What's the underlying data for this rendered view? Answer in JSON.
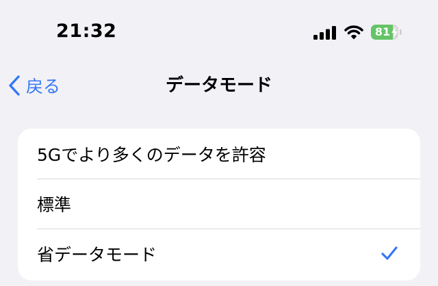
{
  "status_bar": {
    "time": "21:32",
    "battery_level": "81",
    "battery_fraction": 0.81,
    "signal_icon": "cellular-signal-icon",
    "wifi_icon": "wifi-icon"
  },
  "nav": {
    "back_label": "戻る",
    "title": "データモード"
  },
  "options": {
    "items": [
      {
        "label": "5Gでより多くのデータを許容",
        "selected": false
      },
      {
        "label": "標準",
        "selected": false
      },
      {
        "label": "省データモード",
        "selected": true
      }
    ]
  },
  "colors": {
    "accent": "#3478f6",
    "battery": "#64c466",
    "background": "#f2f1f6"
  }
}
